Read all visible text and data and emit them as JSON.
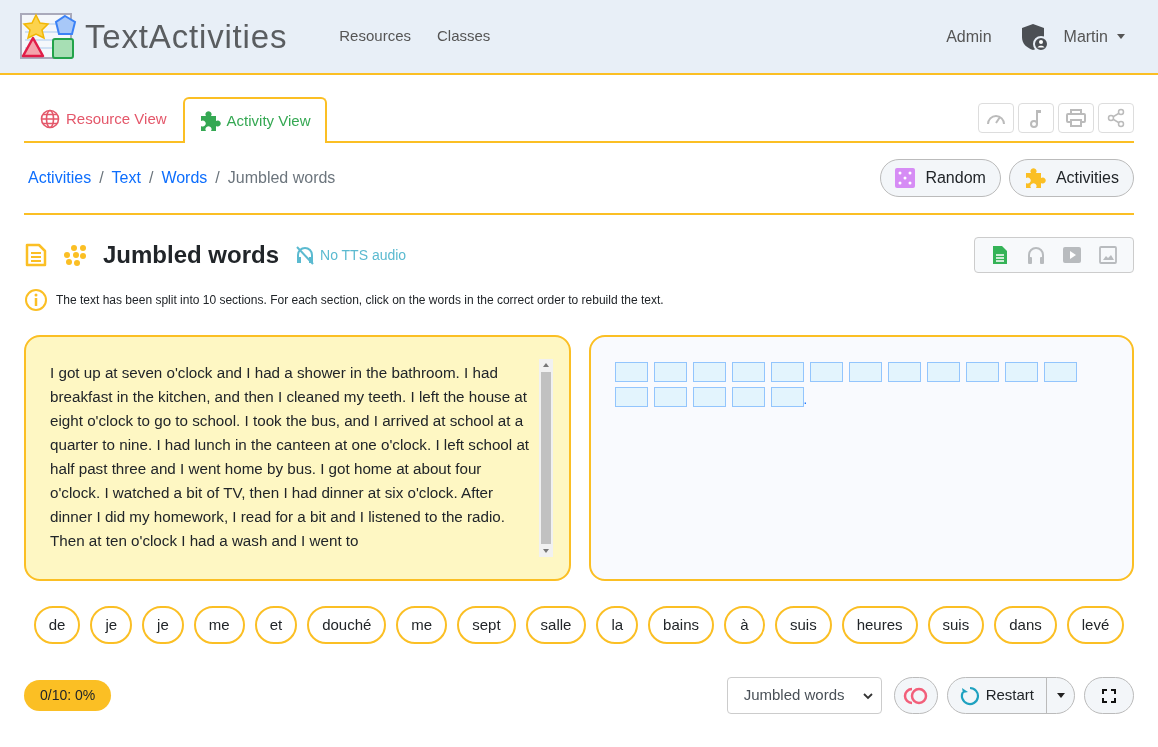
{
  "header": {
    "brand": "TextActivities",
    "nav": [
      "Resources",
      "Classes"
    ],
    "admin": "Admin",
    "user": "Martin"
  },
  "tabs": [
    {
      "label": "Resource View",
      "selected": false,
      "kind": "globe"
    },
    {
      "label": "Activity View",
      "selected": true,
      "kind": "puzzle"
    }
  ],
  "breadcrumb": {
    "links": [
      {
        "label": "Activities",
        "separator": "/"
      },
      {
        "label": "Text",
        "separator": "/"
      },
      {
        "label": "Words",
        "separator": "/"
      }
    ],
    "current": "Jumbled words"
  },
  "actions": [
    {
      "label": "Random",
      "kind": "dice"
    },
    {
      "label": "Activities",
      "kind": "puzzle"
    }
  ],
  "activity": {
    "title": "Jumbled words",
    "tts": "No TTS audio",
    "info": "The text has been split into 10 sections. For each section, click on the words in the correct order to rebuild the text."
  },
  "media": [
    {
      "kind": "text",
      "selected": true
    },
    {
      "kind": "audio",
      "selected": false
    },
    {
      "kind": "video",
      "selected": false
    },
    {
      "kind": "image",
      "selected": false
    }
  ],
  "text_panel": {
    "text": "I got up at seven o'clock and I had a shower in the bathroom. I had breakfast in the kitchen, and then I cleaned my teeth. I left the house at eight o'clock to go to school. I took the bus, and I arrived at school at a quarter to nine. I had lunch in the canteen at one o'clock. I left school at half past three and I went home by bus. I got home at about four o'clock. I watched a bit of TV, then I had dinner at six o'clock. After dinner I did my homework, I read for a bit and I listened to the radio. Then at ten o'clock I had a wash and I went to"
  },
  "answer": {
    "slots": [
      {
        "filled": false
      },
      {
        "filled": false
      },
      {
        "filled": false
      },
      {
        "filled": false
      },
      {
        "filled": false
      },
      {
        "filled": false
      },
      {
        "filled": false
      },
      {
        "filled": false
      },
      {
        "filled": false
      },
      {
        "filled": false
      },
      {
        "filled": false
      },
      {
        "filled": false
      },
      {
        "filled": false
      },
      {
        "filled": false
      },
      {
        "filled": false
      },
      {
        "filled": false
      },
      {
        "filled": false
      }
    ],
    "end_mark": "."
  },
  "words": [
    "de",
    "je",
    "je",
    "me",
    "et",
    "douché",
    "me",
    "sept",
    "salle",
    "la",
    "bains",
    "à",
    "suis",
    "heures",
    "suis",
    "dans",
    "levé"
  ],
  "footer": {
    "progress": "0/10: 0%",
    "mode": "Jumbled words",
    "restart": "Restart"
  }
}
